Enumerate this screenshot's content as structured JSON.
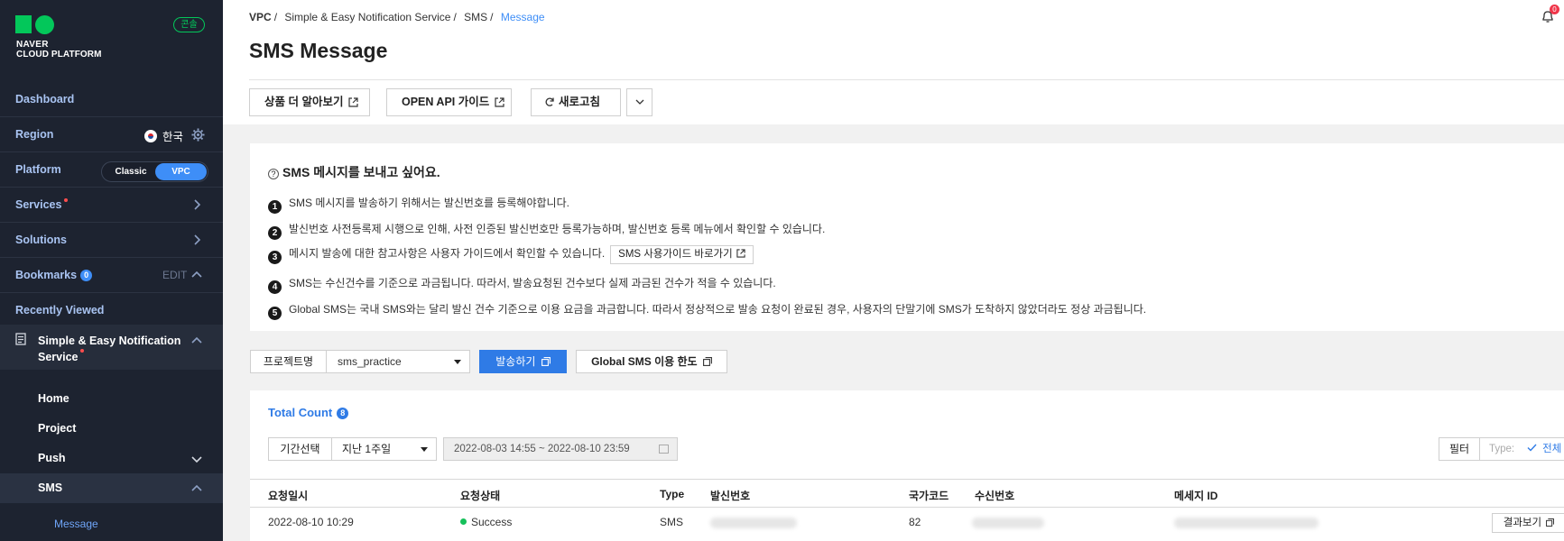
{
  "sidebar": {
    "logo_line1": "NAVER",
    "logo_line2": "CLOUD PLATFORM",
    "console_badge": "콘솔",
    "dashboard": "Dashboard",
    "region_label": "Region",
    "region_value": "한국",
    "platform_label": "Platform",
    "platform_classic": "Classic",
    "platform_vpc": "VPC",
    "services": "Services",
    "solutions": "Solutions",
    "bookmarks": "Bookmarks",
    "bookmarks_count": "0",
    "bookmarks_edit": "EDIT",
    "recently_viewed": "Recently Viewed",
    "service_name": "Simple & Easy Notification Service",
    "sub_items": [
      "Home",
      "Project",
      "Push",
      "SMS"
    ],
    "leaf_item": "Message"
  },
  "header": {
    "breadcrumb": [
      "VPC",
      "Simple & Easy Notification Service",
      "SMS",
      "Message"
    ],
    "notification_count": "0",
    "title": "SMS Message",
    "btn_learn_more": "상품 더 알아보기",
    "btn_api_guide": "OPEN API 가이드",
    "btn_refresh": "새로고침"
  },
  "info": {
    "heading": "SMS 메시지를 보내고 싶어요.",
    "lines": [
      "SMS 메시지를 발송하기 위해서는 발신번호를 등록해야합니다.",
      "발신번호 사전등록제 시행으로 인해, 사전 인증된 발신번호만 등록가능하며, 발신번호 등록 메뉴에서 확인할 수 있습니다.",
      "메시지 발송에 대한 참고사항은 사용자 가이드에서 확인할 수 있습니다.",
      "SMS는 수신건수를 기준으로 과금됩니다. 따라서, 발송요청된 건수보다 실제 과금된 건수가 적을 수 있습니다.",
      "Global SMS는 국내 SMS와는 달리 발신 건수 기준으로 이용 요금을 과금합니다. 따라서 정상적으로 발송 요청이 완료된 경우, 사용자의 단말기에 SMS가 도착하지 않았더라도 정상 과금됩니다."
    ],
    "numbers": [
      "1",
      "2",
      "3",
      "4",
      "5"
    ],
    "guide_link": "SMS 사용가이드 바로가기"
  },
  "project_bar": {
    "label": "프로젝트명",
    "selected": "sms_practice",
    "send": "발송하기",
    "global_limit": "Global SMS 이용 한도"
  },
  "list": {
    "total_label": "Total Count",
    "total_count": "8",
    "period_label": "기간선택",
    "period_value": "지난 1주일",
    "date_range": "2022-08-03 14:55 ~ 2022-08-10 23:59",
    "filter": "필터",
    "type_label": "Type:",
    "type_value": "전체",
    "columns": [
      "요청일시",
      "요청상태",
      "Type",
      "발신번호",
      "국가코드",
      "수신번호",
      "메세지 ID"
    ],
    "rows": [
      {
        "date": "2022-08-10 10:29",
        "status": "Success",
        "type": "SMS",
        "country": "82",
        "result": "결과보기"
      }
    ]
  },
  "colors": {
    "sidebar_bg": "#1d2330",
    "accent": "#2f7be6",
    "brand_green": "#03c75a",
    "success": "#16c05a"
  }
}
